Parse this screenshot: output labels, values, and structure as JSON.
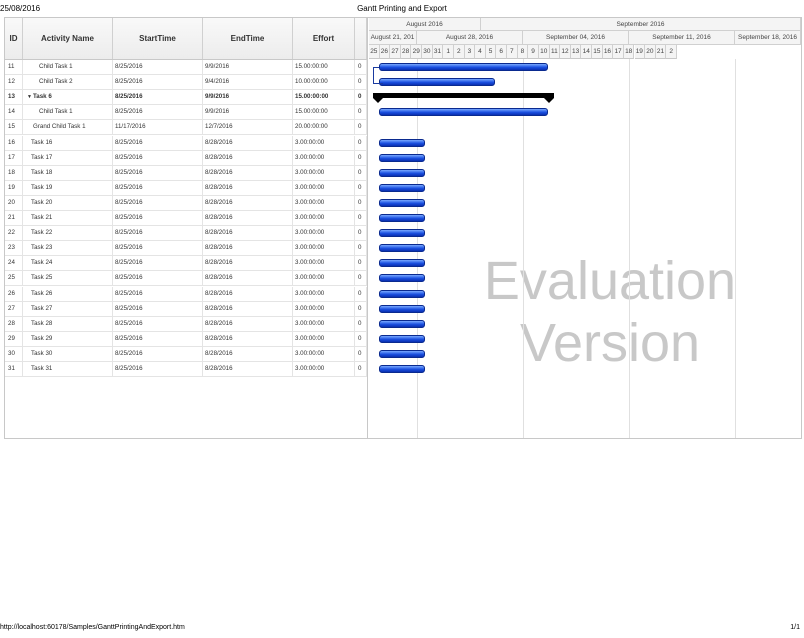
{
  "print_header": {
    "date": "25/08/2016",
    "title": "Gantt Printing and Export"
  },
  "print_footer": {
    "url": "http://localhost:60178/Samples/GanttPrintingAndExport.htm",
    "page": "1/1"
  },
  "columns": [
    "ID",
    "Activity Name",
    "StartTime",
    "EndTime",
    "Effort"
  ],
  "rows": [
    {
      "id": "11",
      "name": "Child Task 1",
      "start": "8/25/2016",
      "end": "9/9/2016",
      "effort": "15.00:00:00",
      "x": "0"
    },
    {
      "id": "12",
      "name": "Child Task 2",
      "start": "8/25/2016",
      "end": "9/4/2016",
      "effort": "10.00:00:00",
      "x": "0"
    },
    {
      "id": "13",
      "name": "Task 6",
      "start": "8/25/2016",
      "end": "9/9/2016",
      "effort": "15.00:00:00",
      "x": "0"
    },
    {
      "id": "14",
      "name": "Child Task 1",
      "start": "8/25/2016",
      "end": "9/9/2016",
      "effort": "15.00:00:00",
      "x": "0"
    },
    {
      "id": "15",
      "name": "Grand Child Task 1",
      "start": "11/17/2016",
      "end": "12/7/2016",
      "effort": "20.00:00:00",
      "x": "0"
    },
    {
      "id": "16",
      "name": "Task 16",
      "start": "8/25/2016",
      "end": "8/28/2016",
      "effort": "3.00:00:00",
      "x": "0"
    },
    {
      "id": "17",
      "name": "Task 17",
      "start": "8/25/2016",
      "end": "8/28/2016",
      "effort": "3.00:00:00",
      "x": "0"
    },
    {
      "id": "18",
      "name": "Task 18",
      "start": "8/25/2016",
      "end": "8/28/2016",
      "effort": "3.00:00:00",
      "x": "0"
    },
    {
      "id": "19",
      "name": "Task 19",
      "start": "8/25/2016",
      "end": "8/28/2016",
      "effort": "3.00:00:00",
      "x": "0"
    },
    {
      "id": "20",
      "name": "Task 20",
      "start": "8/25/2016",
      "end": "8/28/2016",
      "effort": "3.00:00:00",
      "x": "0"
    },
    {
      "id": "21",
      "name": "Task 21",
      "start": "8/25/2016",
      "end": "8/28/2016",
      "effort": "3.00:00:00",
      "x": "0"
    },
    {
      "id": "22",
      "name": "Task 22",
      "start": "8/25/2016",
      "end": "8/28/2016",
      "effort": "3.00:00:00",
      "x": "0"
    },
    {
      "id": "23",
      "name": "Task 23",
      "start": "8/25/2016",
      "end": "8/28/2016",
      "effort": "3.00:00:00",
      "x": "0"
    },
    {
      "id": "24",
      "name": "Task 24",
      "start": "8/25/2016",
      "end": "8/28/2016",
      "effort": "3.00:00:00",
      "x": "0"
    },
    {
      "id": "25",
      "name": "Task 25",
      "start": "8/25/2016",
      "end": "8/28/2016",
      "effort": "3.00:00:00",
      "x": "0"
    },
    {
      "id": "26",
      "name": "Task 26",
      "start": "8/25/2016",
      "end": "8/28/2016",
      "effort": "3.00:00:00",
      "x": "0"
    },
    {
      "id": "27",
      "name": "Task 27",
      "start": "8/25/2016",
      "end": "8/28/2016",
      "effort": "3.00:00:00",
      "x": "0"
    },
    {
      "id": "28",
      "name": "Task 28",
      "start": "8/25/2016",
      "end": "8/28/2016",
      "effort": "3.00:00:00",
      "x": "0"
    },
    {
      "id": "29",
      "name": "Task 29",
      "start": "8/25/2016",
      "end": "8/28/2016",
      "effort": "3.00:00:00",
      "x": "0"
    },
    {
      "id": "30",
      "name": "Task 30",
      "start": "8/25/2016",
      "end": "8/28/2016",
      "effort": "3.00:00:00",
      "x": "0"
    },
    {
      "id": "31",
      "name": "Task 31",
      "start": "8/25/2016",
      "end": "8/28/2016",
      "effort": "3.00:00:00",
      "x": "0"
    }
  ],
  "timeline": {
    "months": [
      "August 2016",
      "September 2016"
    ],
    "weeks": [
      "August 21, 201",
      "August 28, 2016",
      "September 04, 2016",
      "September 11, 2016",
      "September 18, 2016"
    ],
    "days": [
      "25",
      "26",
      "27",
      "28",
      "29",
      "30",
      "31",
      "1",
      "2",
      "3",
      "4",
      "5",
      "6",
      "7",
      "8",
      "9",
      "10",
      "11",
      "12",
      "13",
      "14",
      "15",
      "16",
      "17",
      "18",
      "19",
      "20",
      "21",
      "2"
    ]
  },
  "watermark": {
    "line1": "Evaluation",
    "line2": "Version"
  },
  "colors": {
    "bar": "#1a4fe0",
    "summary": "#000000",
    "grid": "#c8c8c8"
  }
}
